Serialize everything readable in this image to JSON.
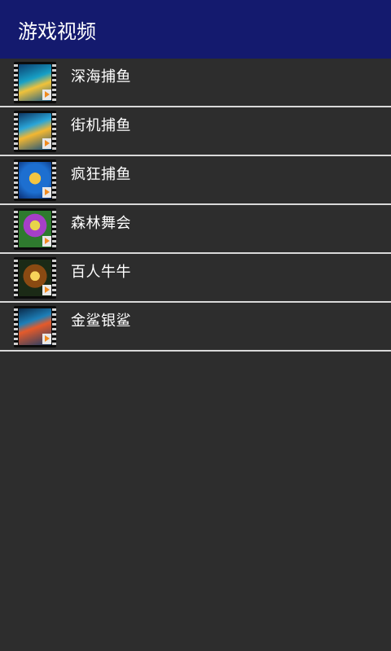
{
  "app_bar": {
    "title": "游戏视频",
    "background": "#141a6e"
  },
  "videos": [
    {
      "label": "深海捕鱼",
      "thumbnail_icon": "video-thumbnail-icon"
    },
    {
      "label": "街机捕鱼",
      "thumbnail_icon": "video-thumbnail-icon"
    },
    {
      "label": "疯狂捕鱼",
      "thumbnail_icon": "video-thumbnail-icon"
    },
    {
      "label": "森林舞会",
      "thumbnail_icon": "video-thumbnail-icon"
    },
    {
      "label": "百人牛牛",
      "thumbnail_icon": "video-thumbnail-icon"
    },
    {
      "label": "金鲨银鲨",
      "thumbnail_icon": "video-thumbnail-icon"
    }
  ],
  "colors": {
    "background": "#2d2d2d",
    "divider": "#d9d9d9",
    "play_badge": "#f08a1e"
  }
}
